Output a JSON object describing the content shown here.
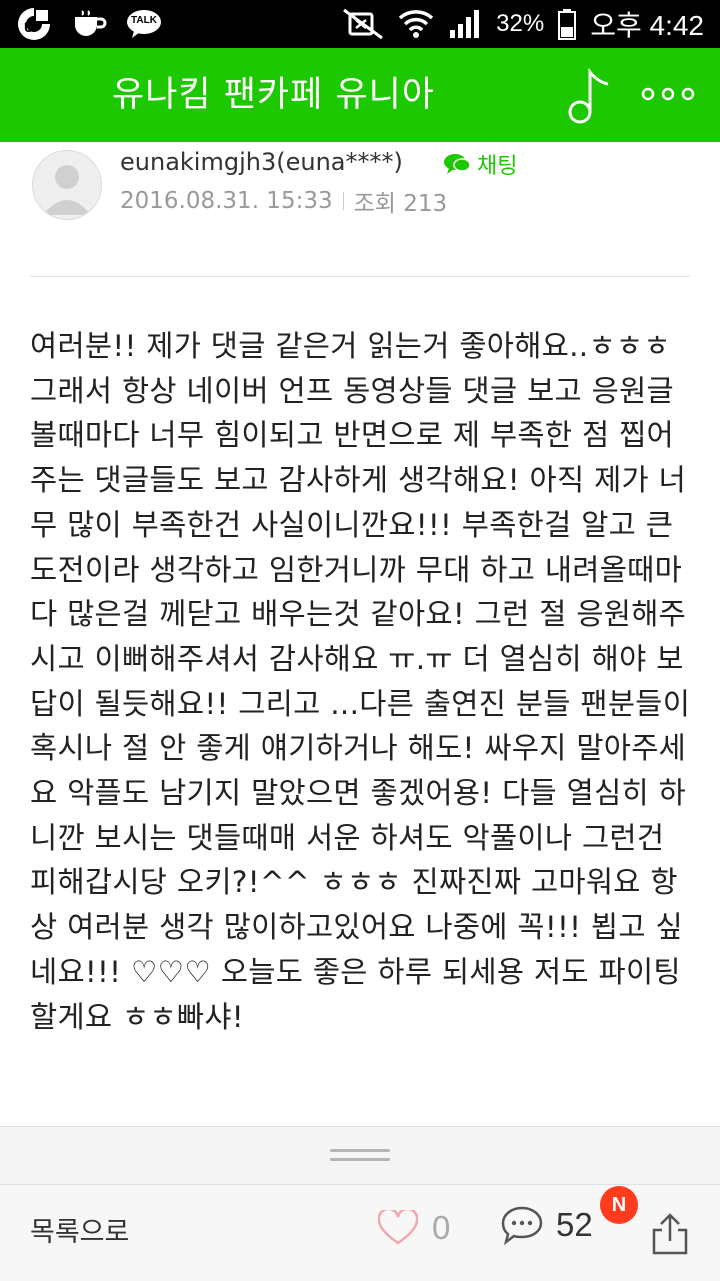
{
  "status_bar": {
    "battery_percent": "32%",
    "time": "오후 4:42",
    "icons": [
      "u-app-icon",
      "coffee-icon",
      "talk-icon",
      "mute-icon",
      "wifi-icon",
      "signal-icon",
      "battery-icon"
    ],
    "talk_label": "TALK"
  },
  "app_bar": {
    "title": "유나킴 팬카페 유니아",
    "background": "#1ec800",
    "icons": [
      "music-note-icon",
      "more-icon"
    ]
  },
  "post": {
    "author": "eunakimgjh3(euna****)",
    "chat_label": "채팅",
    "date": "2016.08.31. 15:33",
    "views_label": "조회 213",
    "body": "여러분!! 제가 댓글 같은거 읽는거 좋아해요..ㅎㅎㅎ 그래서 항상 네이버 언프 동영상들 댓글 보고 응원글볼때마다 너무 힘이되고 반면으로 제 부족한 점 찝어주는 댓글들도 보고 감사하게 생각해요! 아직 제가 너무 많이 부족한건 사실이니깐요!!! 부족한걸 알고 큰 도전이라 생각하고 임한거니까 무대 하고 내려올때마다 많은걸 께닫고 배우는것 같아요! 그런 절 응원해주시고 이뻐해주셔서 감사해요 ㅠ.ㅠ 더 열심히 해야 보답이 될듯해요!! 그리고 ...다른 출연진 분들 팬분들이 혹시나 절 안 좋게 얘기하거나 해도! 싸우지 말아주세요 악플도 남기지 말았으면 좋겠어용! 다들 열심히 하니깐 보시는 댓들때매 서운 하셔도 악풀이나 그런건 피해갑시당 오키?!^^ ㅎㅎㅎ 진짜진짜 고마워요 항상 여러분 생각 많이하고있어요 나중에 꼭!!! 뵙고 싶네요!!! ♡♡♡ 오늘도 좋은 하루 되세용 저도 파이팅 할게요 ㅎㅎ빠샤!"
  },
  "bottom_bar": {
    "back_label": "목록으로",
    "like_count": "0",
    "comment_count": "52",
    "new_badge": "N",
    "accent": "#ff3c1e"
  }
}
